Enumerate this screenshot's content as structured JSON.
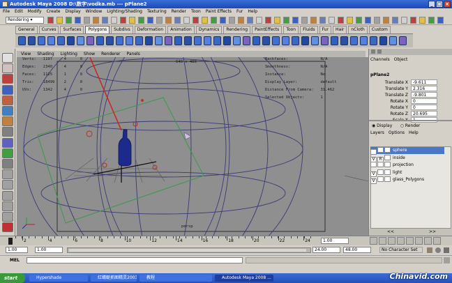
{
  "window": {
    "title": "Autodesk Maya 2008 D:\\数字\\vodka.mb  ---  pPlane2"
  },
  "menubar": [
    "File",
    "Edit",
    "Modify",
    "Create",
    "Display",
    "Window",
    "Lighting/Shading",
    "Texturing",
    "Render",
    "Toon",
    "Paint Effects",
    "Fur",
    "Help"
  ],
  "statusline": {
    "mode": "Rendering"
  },
  "shelf_tabs": [
    "General",
    "Curves",
    "Surfaces",
    "Polygons",
    "Subdivs",
    "Deformation",
    "Animation",
    "Dynamics",
    "Rendering",
    "PaintEffects",
    "Toon",
    "Fluids",
    "Fur",
    "Hair",
    "nCloth",
    "Custom"
  ],
  "shelf_active": "Polygons",
  "viewport": {
    "menu": [
      "View",
      "Shading",
      "Lighting",
      "Show",
      "Renderer",
      "Panels"
    ],
    "hud_left": [
      {
        "label": "Verts:",
        "a": "1197",
        "b": "4",
        "c": "0"
      },
      {
        "label": "Edges:",
        "a": "2340",
        "b": "4",
        "c": "0"
      },
      {
        "label": "Faces:",
        "a": "1125",
        "b": "1",
        "c": "0"
      },
      {
        "label": "Tris:",
        "a": "18499",
        "b": "2",
        "c": "0"
      },
      {
        "label": "UVs:",
        "a": "1342",
        "b": "4",
        "c": "0"
      }
    ],
    "hud_center": "640 x 480",
    "hud_right": [
      {
        "label": "Backfaces:",
        "value": "N/A"
      },
      {
        "label": "Smoothness:",
        "value": "N/A"
      },
      {
        "label": "Instance:",
        "value": "No"
      },
      {
        "label": "Display Layer:",
        "value": "default"
      },
      {
        "label": "Distance From Camera:",
        "value": "31.462"
      },
      {
        "label": "Selected Objects:",
        "value": "1"
      }
    ],
    "camera_label": "persp"
  },
  "channel_box": {
    "menu": [
      "Channels",
      "Object"
    ],
    "object": "pPlane2",
    "attributes": [
      {
        "name": "Translate X",
        "value": "-9.611"
      },
      {
        "name": "Translate Y",
        "value": "2.316"
      },
      {
        "name": "Translate Z",
        "value": "-9.801"
      },
      {
        "name": "Rotate X",
        "value": "0"
      },
      {
        "name": "Rotate Y",
        "value": "0"
      },
      {
        "name": "Rotate Z",
        "value": "20.695"
      },
      {
        "name": "Scale X",
        "value": "1"
      }
    ]
  },
  "layer_editor": {
    "mode_display": "Display",
    "mode_render": "Render",
    "menu": [
      "Layers",
      "Options",
      "Help"
    ],
    "layers": [
      {
        "v": "V",
        "r": "",
        "name": "sphere",
        "selected": true
      },
      {
        "v": "V",
        "r": "R",
        "name": "inside",
        "selected": false
      },
      {
        "v": "",
        "r": "",
        "name": "projection",
        "selected": false
      },
      {
        "v": "V",
        "r": "",
        "name": "light",
        "selected": false
      },
      {
        "v": "V",
        "r": "",
        "name": "glass_Polygons",
        "selected": false
      }
    ],
    "scroll_left": "<<",
    "scroll_right": ">>"
  },
  "timeline": {
    "ticks": [
      "2",
      "4",
      "6",
      "8",
      "10",
      "12",
      "14",
      "16",
      "18",
      "20",
      "22",
      "24"
    ],
    "current": "1.00"
  },
  "range": {
    "start": "1.00",
    "playback_start": "1.00",
    "playback_end": "24.00",
    "end": "48.00",
    "character_set": "No Character Set"
  },
  "command_line": {
    "label": "MEL"
  },
  "taskbar": {
    "start": "start",
    "tasks": [
      "Hypershade",
      "红蜻蜓抓图精灵2003",
      "教程",
      "Autodesk Maya 2008 ..."
    ]
  },
  "watermark": "Chinavid.com"
}
